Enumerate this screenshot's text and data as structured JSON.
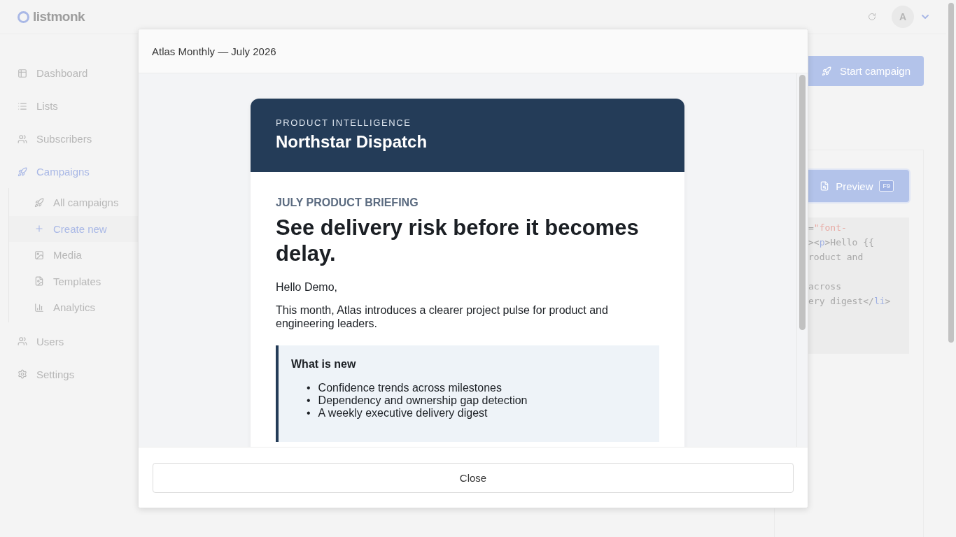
{
  "header": {
    "logo": "listmonk",
    "avatar": "A"
  },
  "sidebar": {
    "items": [
      {
        "label": "Dashboard",
        "selected": false
      },
      {
        "label": "Lists",
        "selected": false
      },
      {
        "label": "Subscribers",
        "selected": false
      },
      {
        "label": "Campaigns",
        "selected": true,
        "expanded": true,
        "children": [
          {
            "label": "All campaigns",
            "selected": false
          },
          {
            "label": "Create new",
            "selected": true
          },
          {
            "label": "Media",
            "selected": false
          },
          {
            "label": "Templates",
            "selected": false
          },
          {
            "label": "Analytics",
            "selected": false
          }
        ]
      },
      {
        "label": "Users",
        "selected": false
      },
      {
        "label": "Settings",
        "selected": false
      }
    ]
  },
  "main": {
    "start_button": "Start campaign",
    "preview_button": {
      "label": "Preview",
      "shortcut": "F9"
    },
    "code_lines": [
      {
        "segments": [
          {
            "kind": "plain",
            "text": "="
          },
          {
            "kind": "string",
            "text": "\"font-"
          }
        ]
      },
      {
        "segments": [
          {
            "kind": "plain",
            "text": "><"
          },
          {
            "kind": "tag",
            "text": "p"
          },
          {
            "kind": "plain",
            "text": ">Hello {{"
          }
        ]
      },
      {
        "segments": [
          {
            "kind": "plain",
            "text": "roduct and"
          }
        ]
      },
      {
        "blank_before": true,
        "segments": [
          {
            "kind": "plain",
            "text": "across"
          }
        ]
      },
      {
        "segments": [
          {
            "kind": "plain",
            "text": "ery digest</"
          },
          {
            "kind": "tag",
            "text": "li"
          },
          {
            "kind": "plain",
            "text": ">"
          }
        ]
      }
    ]
  },
  "modal": {
    "title": "Atlas Monthly — July 2026",
    "email": {
      "eyebrow": "PRODUCT INTELLIGENCE",
      "brand": "Northstar Dispatch",
      "kicker": "JULY PRODUCT BRIEFING",
      "headline": "See delivery risk before it becomes delay.",
      "greeting": "Hello Demo,",
      "intro": "This month, Atlas introduces a clearer project pulse for product and engineering leaders.",
      "callout": {
        "title": "What is new",
        "items": [
          {
            "bullet": "•",
            "text": "Confidence trends across milestones"
          },
          {
            "bullet": "•",
            "text": "Dependency and ownership gap detection"
          },
          {
            "bullet": "•",
            "text": "A weekly executive delivery digest"
          }
        ]
      }
    },
    "close_button": "Close"
  }
}
